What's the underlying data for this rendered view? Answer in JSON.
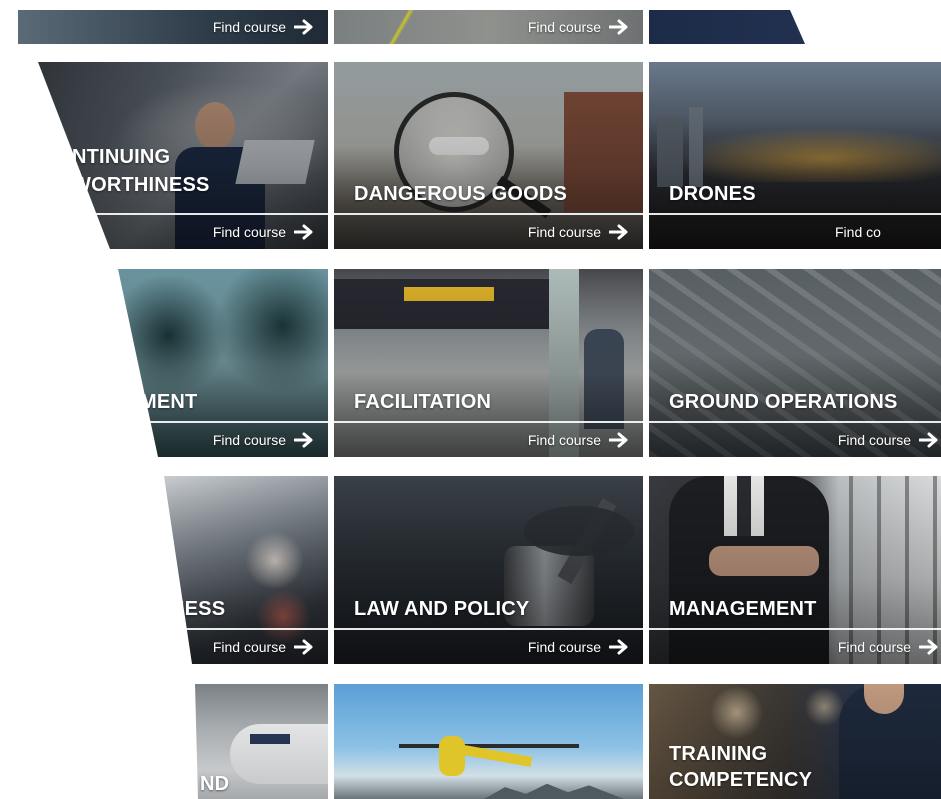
{
  "tiles": {
    "row0": {
      "a": {
        "find": "Find course"
      },
      "b": {
        "find": "Find course"
      }
    },
    "continuing": {
      "title": "NTINUING\nWORTHINESS",
      "line1": "NTINUING",
      "line2": "WORTHINESS",
      "find": "Find course"
    },
    "dangerous": {
      "title": "DANGEROUS GOODS",
      "find": "Find course"
    },
    "drones": {
      "title": "DRONES",
      "find": "Find co"
    },
    "environment": {
      "title": "MENT",
      "find": "Find course"
    },
    "facilitation": {
      "title": "FACILITATION",
      "find": "Find course"
    },
    "ground": {
      "title": "GROUND OPERATIONS",
      "find": "Find course"
    },
    "ness": {
      "title": "NESS",
      "find": "Find course"
    },
    "law": {
      "title": "LAW AND POLICY",
      "find": "Find course"
    },
    "management": {
      "title": "MANAGEMENT",
      "find": "Find course"
    },
    "nd": {
      "title": "ND"
    },
    "helicopter": {},
    "training": {
      "line1": "TRAINING",
      "line2": "COMPETENCY"
    }
  },
  "colors": {
    "background": "#ffffff",
    "text": "#ffffff"
  },
  "icons": {
    "arrow": "arrow-right-icon"
  }
}
